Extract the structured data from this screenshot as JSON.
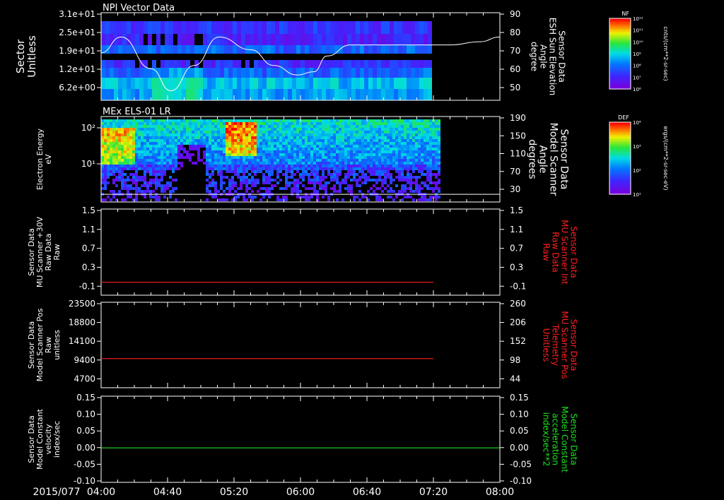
{
  "date_label": "2015/077",
  "x_ticks": [
    "04:00",
    "04:40",
    "05:20",
    "06:00",
    "06:40",
    "07:20",
    "08:00"
  ],
  "colors": {
    "red_trace": "#ff2020",
    "green_trace": "#20e020",
    "white_trace": "#ffffff",
    "bg": "#000000"
  },
  "chart_data": [
    {
      "type": "heatmap",
      "title": "NPI Vector Data",
      "ylabel_lines": [
        "Sector",
        "Unitless"
      ],
      "y_ticks": [
        "3.1e+01",
        "2.5e+01",
        "1.9e+01",
        "1.2e+01",
        "6.2e+00"
      ],
      "right_ticks": [
        "90",
        "80",
        "70",
        "60",
        "50"
      ],
      "right_label_lines": [
        "Sensor Data",
        "ESH Sun Elevation",
        "Angle",
        "degree"
      ],
      "colorbar": {
        "title": "NF",
        "unit": "cnts/(cm**2-sr-sec)",
        "ticks": [
          "10¹²",
          "10¹¹",
          "10¹⁰",
          "10⁹",
          "10⁸",
          "10⁷",
          "10⁶"
        ]
      },
      "overlay_series": {
        "name": "ESH Sun Elevation Angle",
        "x": [
          "04:00",
          "04:12",
          "04:30",
          "04:42",
          "04:56",
          "05:11",
          "05:30",
          "05:44",
          "05:58",
          "06:08",
          "06:16",
          "06:30",
          "07:00",
          "07:30",
          "07:48",
          "08:00"
        ],
        "y": [
          70,
          80,
          60,
          46,
          62,
          80,
          72,
          62,
          56,
          58,
          68,
          75,
          75,
          75,
          77,
          80
        ],
        "ylim": [
          40,
          90
        ]
      }
    },
    {
      "type": "heatmap",
      "title": "MEx ELS-01 LR",
      "ylabel_lines": [
        "Electron Energy",
        "eV"
      ],
      "y_ticks": [
        "10²",
        "10¹"
      ],
      "right_ticks": [
        "190",
        "150",
        "110",
        "70",
        "30"
      ],
      "right_label_lines": [
        "Sensor Data",
        "Model Scanner",
        "Angle",
        "degrees"
      ],
      "colorbar": {
        "title": "DEF",
        "unit": "ergs/(cm**2-sr-sec-eV)",
        "ticks": [
          "10⁴",
          "10³",
          "10²",
          "10¹"
        ]
      },
      "overlay_series": {
        "name": "Model Scanner Angle",
        "x": [
          "04:00",
          "08:00"
        ],
        "y": [
          17,
          17
        ],
        "ylim": [
          0,
          190
        ]
      }
    },
    {
      "type": "line",
      "ylabel_lines": [
        "Sensor Data",
        "MU Scanner +30V",
        "Raw Data",
        "Raw"
      ],
      "y_ticks": [
        "1.5",
        "1.1",
        "0.7",
        "0.3",
        "-0.1"
      ],
      "right_ticks": [
        "1.5",
        "1.1",
        "0.7",
        "0.3",
        "-0.1"
      ],
      "right_label_lines": [
        "Sensor Data",
        "MU Scanner Int",
        "Raw Data",
        "Raw"
      ],
      "ylim": [
        -0.3,
        1.5
      ],
      "series": [
        {
          "name": "MU Scanner +30V",
          "color": "#ff2020",
          "x": [
            "04:00",
            "07:20"
          ],
          "y": [
            -0.03,
            -0.03
          ]
        }
      ]
    },
    {
      "type": "line",
      "ylabel_lines": [
        "Sensor Data",
        "Model Scanner Pos",
        "Raw",
        "unitless"
      ],
      "y_ticks": [
        "23500",
        "18800",
        "14100",
        "9400",
        "4700"
      ],
      "right_ticks": [
        "260",
        "206",
        "152",
        "98",
        "44"
      ],
      "right_label_lines": [
        "Sensor Data",
        "MU Scanner Pos",
        "Telemetry",
        "Unitless"
      ],
      "ylim": [
        0,
        23500
      ],
      "series": [
        {
          "name": "Model Scanner Pos",
          "color": "#ff2020",
          "x": [
            "04:00",
            "07:20"
          ],
          "y": [
            8000,
            8000
          ]
        }
      ]
    },
    {
      "type": "line",
      "ylabel_lines": [
        "Sensor Data",
        "Model Constant",
        "velocity",
        "index/sec"
      ],
      "y_ticks": [
        "0.15",
        "0.10",
        "0.05",
        "0.00",
        "-0.05",
        "-0.10"
      ],
      "right_ticks": [
        "0.15",
        "0.10",
        "0.05",
        "0.00",
        "-0.05",
        "-0.10"
      ],
      "right_label_lines": [
        "Sensor Data",
        "Model Constant",
        "acceleration",
        "index/sec**2"
      ],
      "ylim": [
        -0.1,
        0.15
      ],
      "series": [
        {
          "name": "Model Constant velocity",
          "color": "#20e020",
          "x": [
            "04:00",
            "08:00"
          ],
          "y": [
            0,
            0
          ]
        }
      ]
    }
  ]
}
